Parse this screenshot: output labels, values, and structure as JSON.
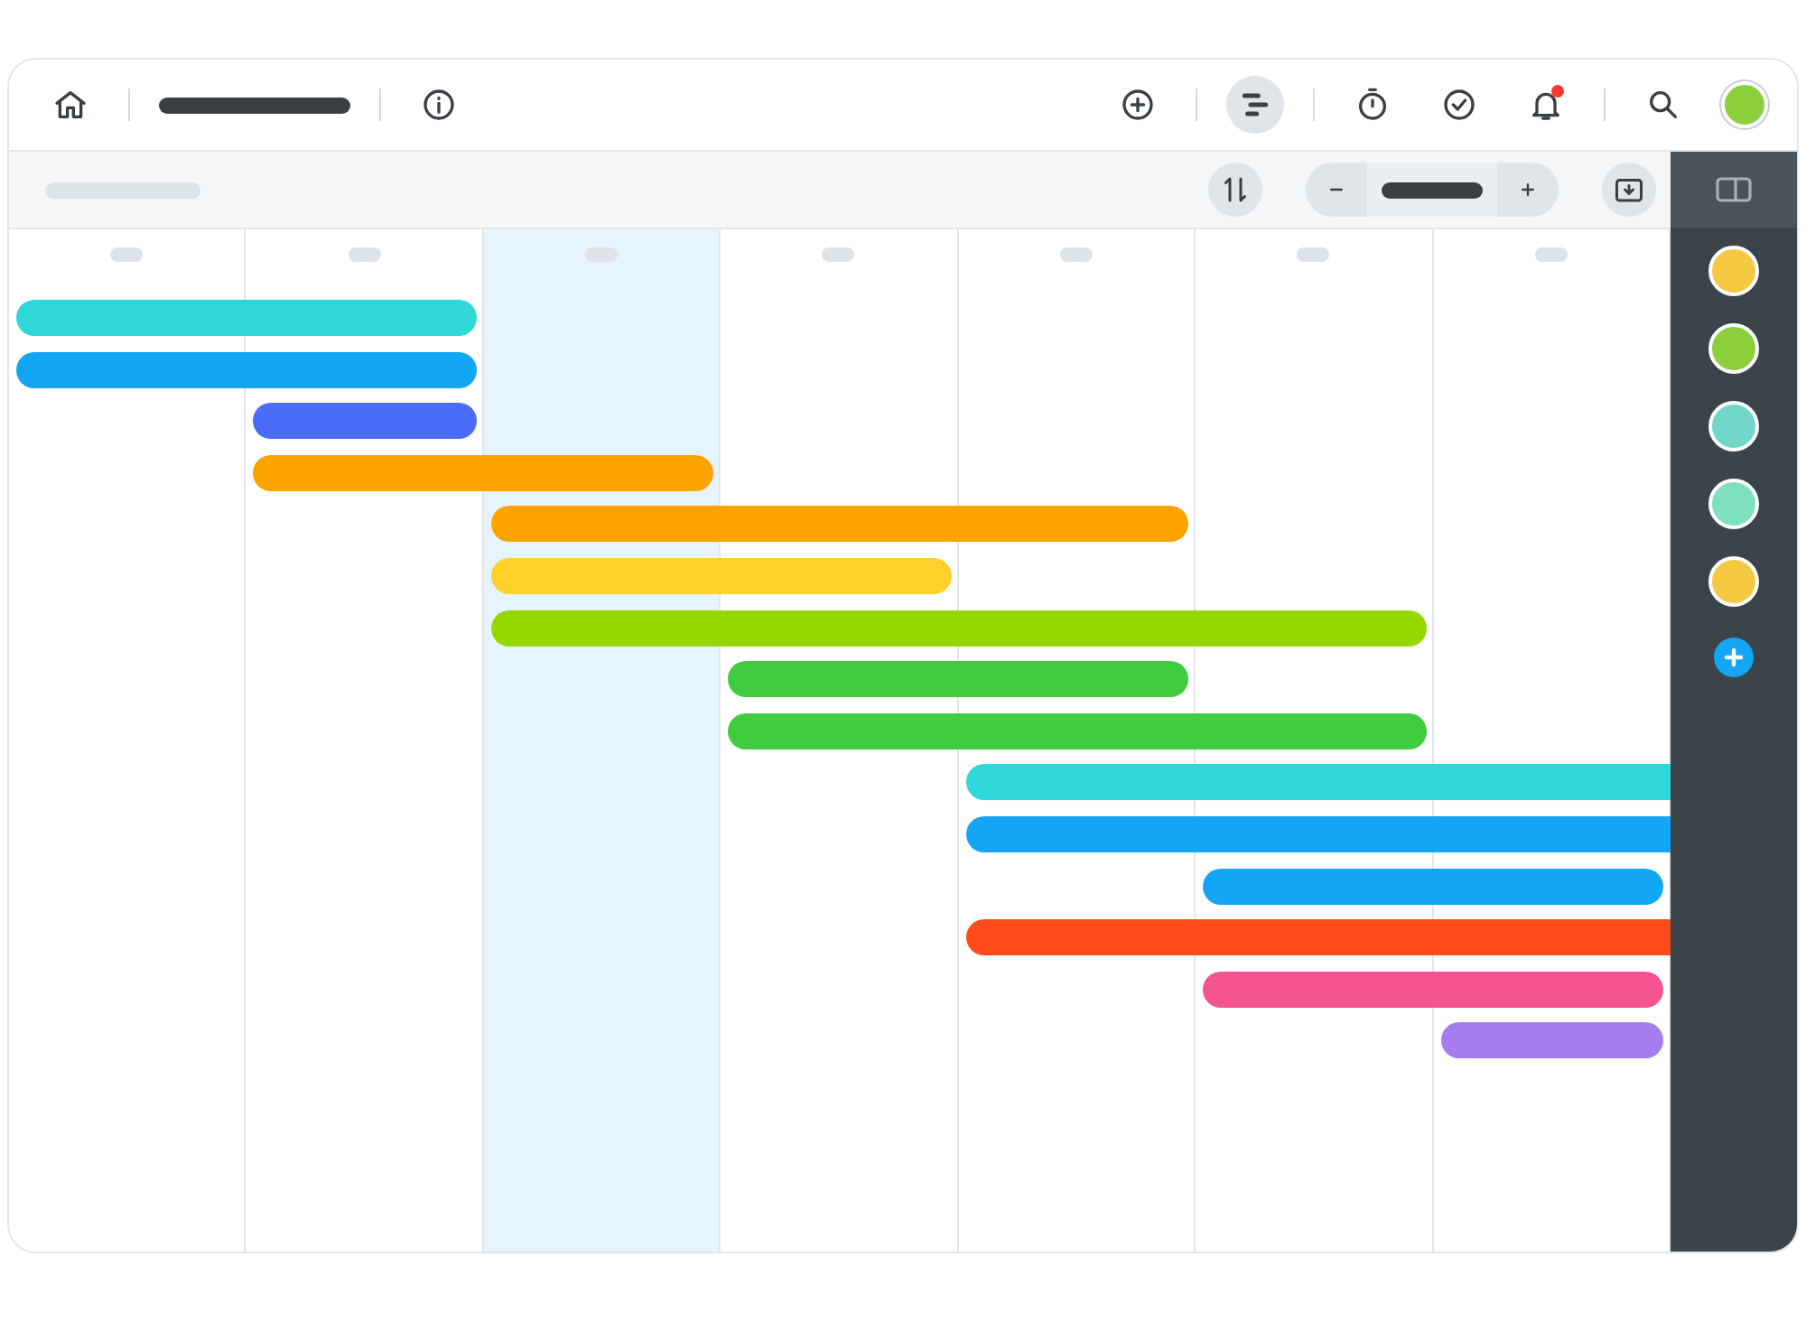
{
  "nav_buttons": [
    {
      "kind": "add",
      "selected": false,
      "badge": false
    },
    {
      "kind": "gantt",
      "selected": true,
      "badge": false
    },
    {
      "kind": "timer",
      "selected": false,
      "badge": false
    },
    {
      "kind": "tasks",
      "selected": false,
      "badge": false
    },
    {
      "kind": "notifications",
      "selected": false,
      "badge": true
    }
  ],
  "columns": [
    {
      "selected": false
    },
    {
      "selected": false
    },
    {
      "selected": true
    },
    {
      "selected": false
    },
    {
      "selected": false
    },
    {
      "selected": false
    },
    {
      "selected": false
    }
  ],
  "tasks": [
    {
      "color": "#2ed8d8"
    },
    {
      "color": "#12a6f5"
    },
    {
      "color": "#4a6cf7"
    },
    {
      "color": "#fba400"
    },
    {
      "color": "#fba400"
    },
    {
      "color": "#ffd12a"
    },
    {
      "color": "#94d800"
    },
    {
      "color": "#3fcc3f"
    },
    {
      "color": "#3fcc3f"
    },
    {
      "color": "#2ed8d8"
    },
    {
      "color": "#12a6f5"
    },
    {
      "color": "#12a6f5"
    },
    {
      "color": "#ff4a1c"
    },
    {
      "color": "#f45390"
    },
    {
      "color": "#a57df0"
    }
  ],
  "members": [
    {
      "color": "#f5c842"
    },
    {
      "color": "#8ccf3c"
    },
    {
      "color": "#6fd6c8"
    },
    {
      "color": "#7fe0c0"
    },
    {
      "color": "#f5c842"
    }
  ]
}
